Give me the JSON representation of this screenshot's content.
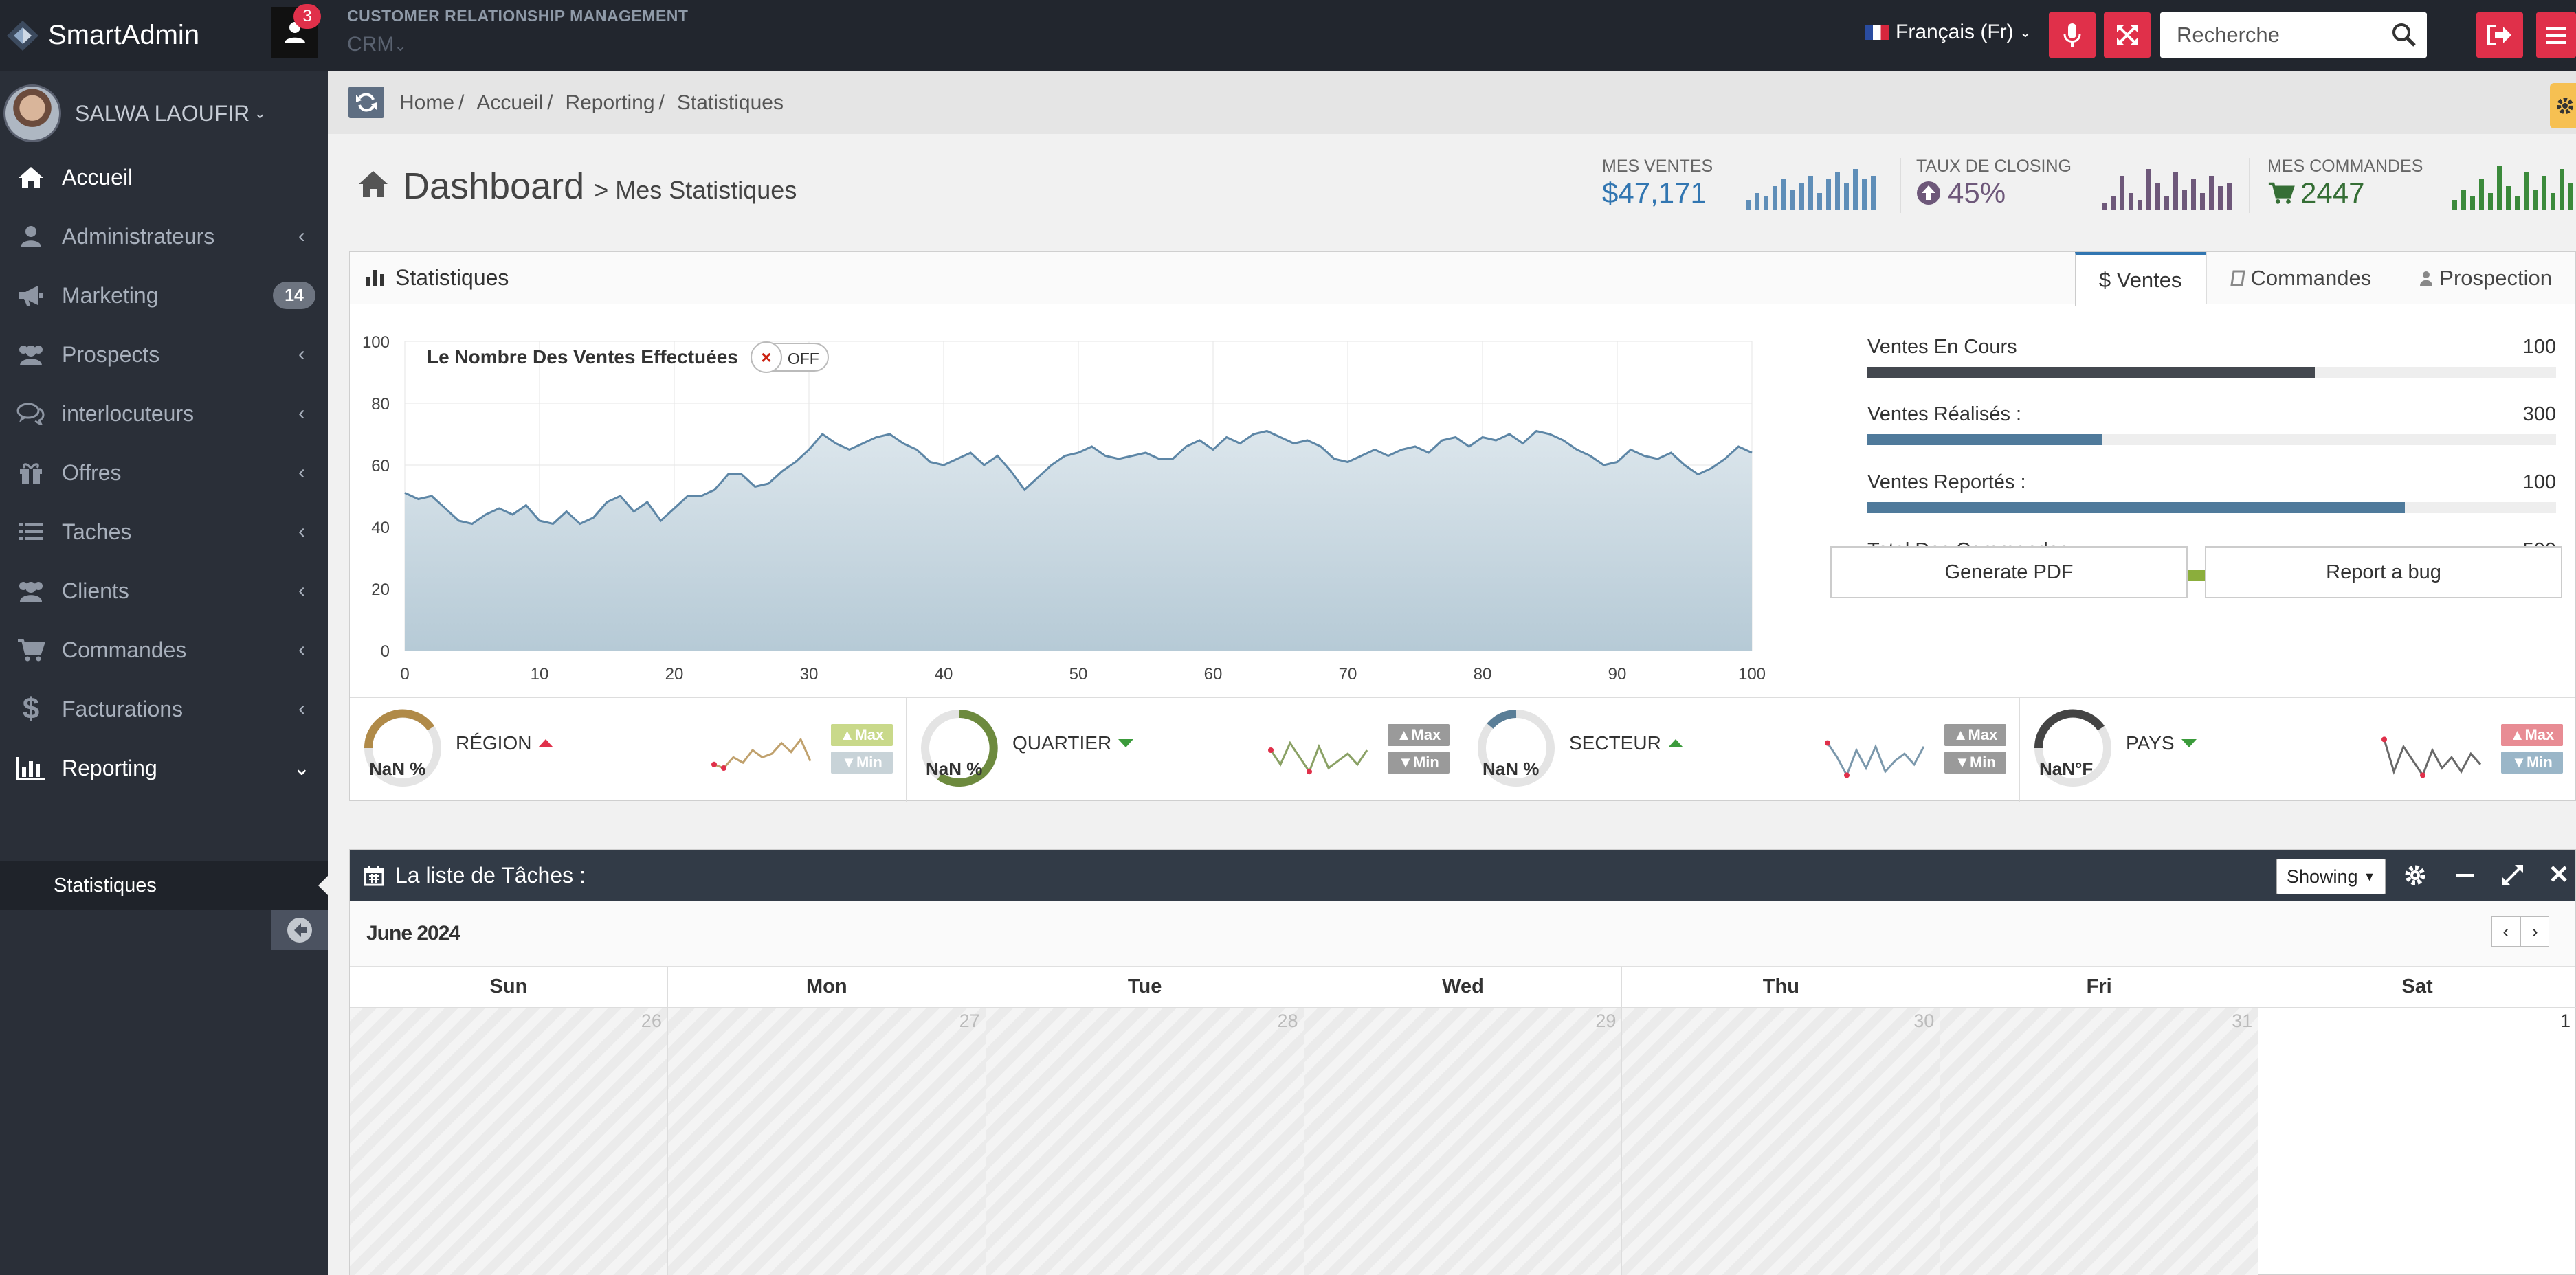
{
  "topbar": {
    "brand": "SmartAdmin",
    "notifications_count": "3",
    "caption": "CUSTOMER RELATIONSHIP MANAGEMENT",
    "project": "CRM",
    "language": "Français (Fr)",
    "search_placeholder": "Recherche"
  },
  "sidebar": {
    "user": "SALWA LAOUFIR",
    "items": [
      {
        "label": "Accueil",
        "icon": "home-icon"
      },
      {
        "label": "Administrateurs",
        "icon": "user-icon"
      },
      {
        "label": "Marketing",
        "icon": "bullhorn-icon",
        "badge": "14"
      },
      {
        "label": "Prospects",
        "icon": "users-icon"
      },
      {
        "label": "interlocuteurs",
        "icon": "comments-icon"
      },
      {
        "label": "Offres",
        "icon": "gift-icon"
      },
      {
        "label": "Taches",
        "icon": "list-icon"
      },
      {
        "label": "Clients",
        "icon": "users-icon"
      },
      {
        "label": "Commandes",
        "icon": "cart-icon"
      },
      {
        "label": "Facturations",
        "icon": "dollar-icon"
      },
      {
        "label": "Reporting",
        "icon": "bar-chart-icon"
      }
    ],
    "sub_item": "Statistiques"
  },
  "breadcrumb": [
    "Home",
    "Accueil",
    "Reporting",
    "Statistiques"
  ],
  "header": {
    "title": "Dashboard",
    "subtitle": "> Mes Statistiques",
    "stats": [
      {
        "label": "MES VENTES",
        "value": "$47,171",
        "color": "#3276b1"
      },
      {
        "label": "TAUX DE CLOSING",
        "value": "45%",
        "color": "#6e587a"
      },
      {
        "label": "MES COMMANDES",
        "value": "2447",
        "color": "#356e35"
      }
    ]
  },
  "stats_panel": {
    "title": "Statistiques",
    "tabs": [
      "$ Ventes",
      "Commandes",
      "Prospection"
    ],
    "legend": "Le Nombre Des Ventes Effectuées",
    "toggle": "OFF",
    "progress": [
      {
        "label": "Ventes En Cours",
        "value": "100",
        "fill": 0.65,
        "color": "#44484f"
      },
      {
        "label": "Ventes Réalisés :",
        "value": "300",
        "fill": 0.34,
        "color": "#4f7a9b"
      },
      {
        "label": "Ventes Reportés :",
        "value": "100",
        "fill": 0.78,
        "color": "#4f7a9b"
      },
      {
        "label": "Total Des Commandes :",
        "value": "500",
        "fill": 0.84,
        "color": "#8bae3c"
      }
    ],
    "buttons": [
      "Generate PDF",
      "Report a bug"
    ],
    "minis": [
      {
        "label": "RÉGION",
        "gauge": "NaN %",
        "trend": "up",
        "trend_color": "#e0304a",
        "color": "#b08a48"
      },
      {
        "label": "QUARTIER",
        "gauge": "NaN %",
        "trend": "down",
        "trend_color": "#3b9b3b",
        "color": "#6d8a3e"
      },
      {
        "label": "SECTEUR",
        "gauge": "NaN %",
        "trend": "up",
        "trend_color": "#3b9b3b",
        "color": "#5a7e97"
      },
      {
        "label": "PAYS",
        "gauge": "NaN°F",
        "trend": "down",
        "trend_color": "#3b9b3b",
        "color": "#444444"
      }
    ],
    "max_label": "Max",
    "min_label": "Min"
  },
  "chart_data": {
    "type": "area",
    "title": "",
    "xlabel": "",
    "ylabel": "",
    "xlim": [
      0,
      100
    ],
    "ylim": [
      0,
      100
    ],
    "x_ticks": [
      "0",
      "10",
      "20",
      "30",
      "40",
      "50",
      "60",
      "70",
      "80",
      "90",
      "100"
    ],
    "y_ticks": [
      "0",
      "20",
      "40",
      "60",
      "80",
      "100"
    ],
    "grid": true,
    "series": [
      {
        "values": [
          51,
          49,
          50,
          46,
          42,
          41,
          44,
          46,
          44,
          47,
          42,
          41,
          45,
          41,
          43,
          48,
          50,
          45,
          48,
          42,
          46,
          50,
          50,
          52,
          57,
          57,
          53,
          54,
          58,
          61,
          65,
          70,
          67,
          65,
          67,
          69,
          70,
          67,
          65,
          61,
          60,
          62,
          64,
          60,
          63,
          58,
          52,
          56,
          60,
          63,
          64,
          66,
          63,
          62,
          63,
          64,
          62,
          62,
          66,
          68,
          65,
          69,
          67,
          70,
          71,
          69,
          67,
          68,
          66,
          62,
          61,
          63,
          65,
          63,
          65,
          66,
          64,
          68,
          69,
          66,
          69,
          68,
          70,
          67,
          71,
          70,
          68,
          65,
          63,
          60,
          61,
          65,
          63,
          62,
          64,
          60,
          57,
          59,
          62,
          66,
          64
        ]
      }
    ]
  },
  "tasks": {
    "title": "La liste de Tâches :",
    "showing": "Showing",
    "month": "June 2024",
    "days": [
      "Sun",
      "Mon",
      "Tue",
      "Wed",
      "Thu",
      "Fri",
      "Sat"
    ],
    "dates": [
      "26",
      "27",
      "28",
      "29",
      "30",
      "31",
      "1"
    ]
  }
}
